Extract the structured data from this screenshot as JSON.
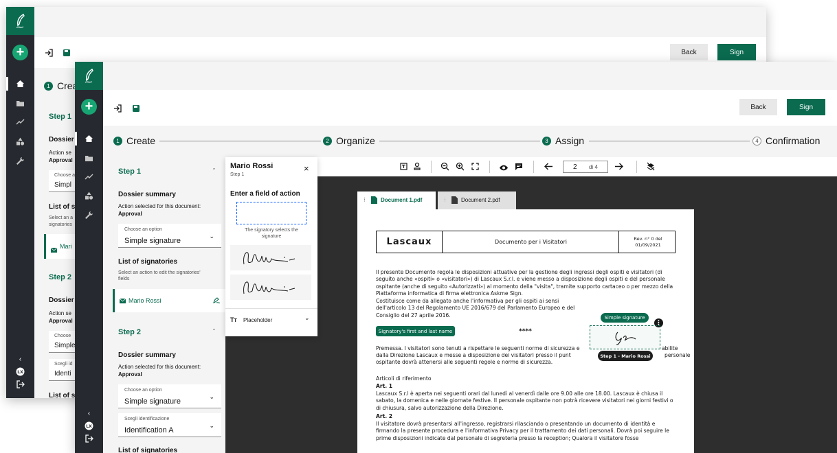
{
  "back": {
    "toolbar": {
      "back_label": "Back",
      "sign_label": "Sign"
    },
    "steps": {
      "step1_partial": "Crea"
    },
    "panel": {
      "step1": "Step 1",
      "dossier_partial": "Dossier",
      "action_partial": "Action se",
      "approval_partial": "Approval",
      "choose_partial": "Choose a",
      "simple_partial": "Simpl",
      "list_partial": "List of si",
      "select_partial_1": "Select an a",
      "select_partial_2": "signatories",
      "mario_partial": "Mari",
      "step2": "Step 2",
      "dossier2_partial": "Dossier",
      "action2_partial": "Action se",
      "approval2_partial": "Approval",
      "choose2_partial": "Choose",
      "simple2_partial": "Simple",
      "scegli_partial": "Scegli id",
      "ident_partial": "Identi",
      "list2_partial": "List of s"
    }
  },
  "front": {
    "toolbar": {
      "back_label": "Back",
      "sign_label": "Sign"
    },
    "steps": [
      {
        "num": "1",
        "label": "Create"
      },
      {
        "num": "2",
        "label": "Organize"
      },
      {
        "num": "3",
        "label": "Assign"
      },
      {
        "num": "4",
        "label": "Confirmation"
      }
    ],
    "panel": {
      "step1_title": "Step 1",
      "dossier_summary": "Dossier summary",
      "action_selected": "Action selected for this document:",
      "approval": "Approval",
      "choose_label": "Choose an option",
      "choose_value": "Simple signature",
      "list_title": "List of signatories",
      "list_hint": "Select an action to edit the signatories' fields",
      "signatory": "Mario Rossi",
      "step2_title": "Step 2",
      "dossier_summary2": "Dossier summary",
      "action_selected2": "Action selected for this document:",
      "approval2": "Approval",
      "choose_label2": "Choose an option",
      "choose_value2": "Simple signature",
      "scegli_label": "Scegli identificazione",
      "scegli_value": "Identification A",
      "list_title2": "List of signatories"
    },
    "popup": {
      "name": "Mario Rossi",
      "step": "Step 1",
      "field_title": "Enter a field of action",
      "hint": "The signatory selects the signature",
      "placeholder": "Placeholder"
    },
    "viewer": {
      "page": "2",
      "of": "di 4",
      "tab1": "Document 1.pdf",
      "tab2": "Document 2.pdf"
    },
    "doc": {
      "logo": "Lascaux",
      "title": "Documento per i Visitatori",
      "rev": "Rev. n° 0 del",
      "rev_date": "01/09/2021",
      "para1": "Il presente Documento regola le disposizioni attuative per la gestione degli ingressi degli ospiti e visitatori (di seguito anche «ospiti» o «visitatori») di Lascaux S.r.l. e viene messo a disposizione degli ospiti e del personale ospitante (anche di seguito «Autorizzati») al momento della \"visita\", tramite supporto cartaceo o per mezzo della Piattaforma informatica di firma elettronica Askme Sign.",
      "para2": "Costituisce come da allegato anche l'informativa per gli ospiti ai sensi dell'articolo 13 del Regolamento UE 2016/679 del Parlamento Europeo e del Consiglio del 27 aprile 2016.",
      "name_field": "Signatory's first and last name",
      "stars": "****",
      "simple_signature": "Simple signature",
      "step_tooltip": "Step 1 - Mario Rossi",
      "premessa_a": "Premessa. I visitatori sono tenuti a rispettare le seguenti norme di sicurezza e",
      "premessa_b": "abilite",
      "premessa_c": "dalla Direzione Lascaux e messe a disposizione dei visitatori presso il punt",
      "premessa_d": "personale",
      "premessa_e": "ospitante dovrà attenersi alle seguenti regole e norme di sicurezza.",
      "articoli": "Articoli di riferimento",
      "art1": "Art. 1",
      "art1_text": "Lascaux S.r.l è aperta nei seguenti orari dal lunedì al venerdì dalle ore 9.00 alle ore 18.00. Lascaux è chiusa il sabato, la domenica e nelle giornate festive. Il personale ospitante non potrà ricevere visitatori nei giorni festivi o di chiusura, salvo autorizzazione della Direzione.",
      "art2": "Art. 2",
      "art2_text": "Il visitatore dovrà presentarsi all'ingresso, registrarsi rilasciando o presentando un documento di identità e firmando la presente procedura e l'informativa Privacy per il trattamento dei dati personali. Dovrà poi seguire le prime disposizioni indicate dal personale di segreteria presso la reception; Qualora il visitatore fosse"
    }
  }
}
